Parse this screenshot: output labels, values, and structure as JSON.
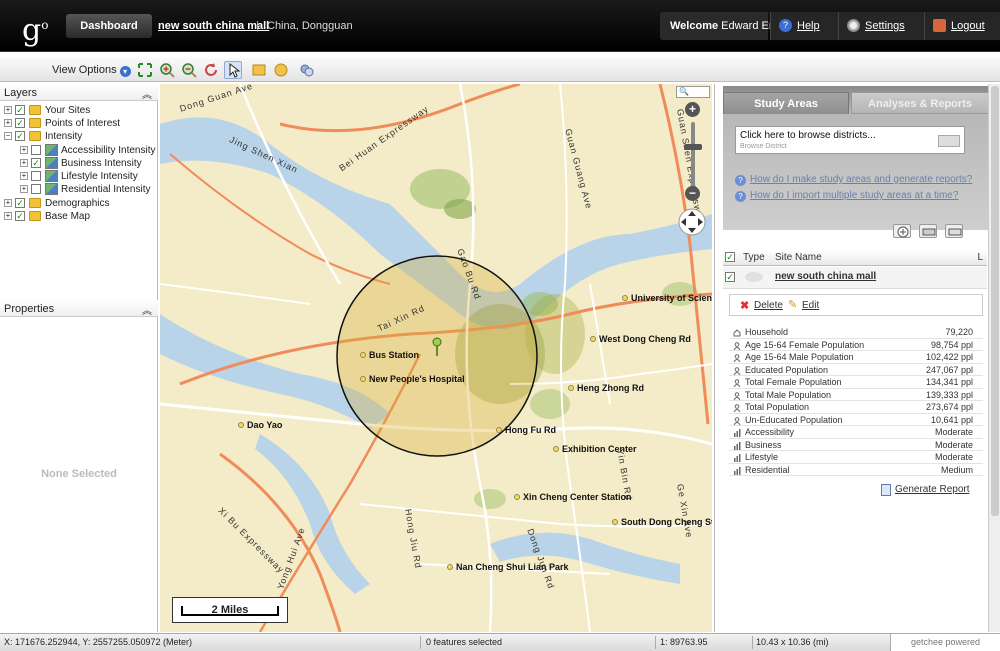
{
  "header": {
    "logo": "g",
    "logo_sup": "o",
    "dashboard_tab": "Dashboard",
    "site_name": "new south china mall",
    "separator": "|",
    "site_location": "China, Dongguan",
    "welcome_prefix": "Welcome",
    "user_name": "Edward Eng",
    "help": "Help",
    "settings": "Settings",
    "logout": "Logout"
  },
  "toolbar": {
    "view_options": "View Options",
    "tools": [
      "full-extent-icon",
      "zoom-in-icon",
      "zoom-out-icon",
      "refresh-icon",
      "pointer-icon",
      "rectangle-select-icon",
      "circle-select-icon",
      "print-icon"
    ]
  },
  "layers": {
    "title": "Layers",
    "items": [
      {
        "label": "Your Sites",
        "checked": true,
        "level": 0,
        "expanded": false
      },
      {
        "label": "Points of Interest",
        "checked": true,
        "level": 0,
        "expanded": false
      },
      {
        "label": "Intensity",
        "checked": true,
        "level": 0,
        "expanded": true
      },
      {
        "label": "Accessibility Intensity",
        "checked": false,
        "level": 1,
        "expanded": false
      },
      {
        "label": "Business Intensity",
        "checked": true,
        "level": 1,
        "expanded": false
      },
      {
        "label": "Lifestyle Intensity",
        "checked": false,
        "level": 1,
        "expanded": false
      },
      {
        "label": "Residential Intensity",
        "checked": false,
        "level": 1,
        "expanded": false
      },
      {
        "label": "Demographics",
        "checked": true,
        "level": 0,
        "expanded": false
      },
      {
        "label": "Base Map",
        "checked": true,
        "level": 0,
        "expanded": false
      }
    ]
  },
  "properties": {
    "title": "Properties",
    "empty": "None Selected"
  },
  "map": {
    "places": [
      {
        "label": "Bus Station"
      },
      {
        "label": "New People's Hospital"
      },
      {
        "label": "Dao Yao"
      },
      {
        "label": "Hong Fu Rd"
      },
      {
        "label": "Exhibition Center"
      },
      {
        "label": "Heng Zhong Rd"
      },
      {
        "label": "West Dong Cheng Rd"
      },
      {
        "label": "University of Science"
      },
      {
        "label": "Xin Cheng Center Station"
      },
      {
        "label": "South Dong Cheng Sta"
      },
      {
        "label": "Nan Cheng Shui Lian Park"
      }
    ],
    "roads": [
      "Dong Guan Ave",
      "Jing Shen Xian",
      "Bei Huan Expressway",
      "Guan Shen Expressway",
      "Guan Guang Ave",
      "Tai Xin Rd",
      "Xi Bu Expressway",
      "Dong Jun Rd",
      "Hong Jiu Rd",
      "Yong Hui Ave",
      "Gao Bu Rd",
      "Yin Bin Rd",
      "Ge Xin Ave"
    ],
    "scale": "2 Miles",
    "zoom_search": "🔍"
  },
  "right_panel": {
    "tabs": [
      "Study Areas",
      "Analyses & Reports"
    ],
    "browse_value": "Click here to browse districts...",
    "browse_placeholder": "Browse District",
    "help_links": [
      "How do I make study areas and generate reports?",
      "How do I import multiple study areas at a time?"
    ],
    "site_header": {
      "type": "Type",
      "name": "Site Name",
      "l": "L"
    },
    "site_row": {
      "name": "new south china mall"
    },
    "site_actions": {
      "delete": "Delete",
      "edit": "Edit"
    },
    "metrics": [
      {
        "icon": "house-icon",
        "label": "Household",
        "value": "79,220"
      },
      {
        "icon": "person-icon",
        "label": "Age 15-64 Female Population",
        "value": "98,754 ppl"
      },
      {
        "icon": "person-icon",
        "label": "Age 15-64 Male Population",
        "value": "102,422 ppl"
      },
      {
        "icon": "person-icon",
        "label": "Educated Population",
        "value": "247,067 ppl"
      },
      {
        "icon": "person-icon",
        "label": "Total Female Population",
        "value": "134,341 ppl"
      },
      {
        "icon": "person-icon",
        "label": "Total Male Population",
        "value": "139,333 ppl"
      },
      {
        "icon": "person-icon",
        "label": "Total Population",
        "value": "273,674 ppl"
      },
      {
        "icon": "person-icon",
        "label": "Un-Educated Population",
        "value": "10,641 ppl"
      },
      {
        "icon": "bar-icon",
        "label": "Accessibility",
        "value": "Moderate"
      },
      {
        "icon": "bar-icon",
        "label": "Business",
        "value": "Moderate"
      },
      {
        "icon": "bar-icon",
        "label": "Lifestyle",
        "value": "Moderate"
      },
      {
        "icon": "bar-icon",
        "label": "Residential",
        "value": "Medium"
      }
    ],
    "generate_report": "Generate Report"
  },
  "status": {
    "coords": "X: 171676.252944, Y: 2557255.050972 (Meter)",
    "selected": "0 features selected",
    "scale": "1: 89763.95",
    "extent": "10.43 x 10.36 (mi)",
    "powered": "getchee powered"
  }
}
